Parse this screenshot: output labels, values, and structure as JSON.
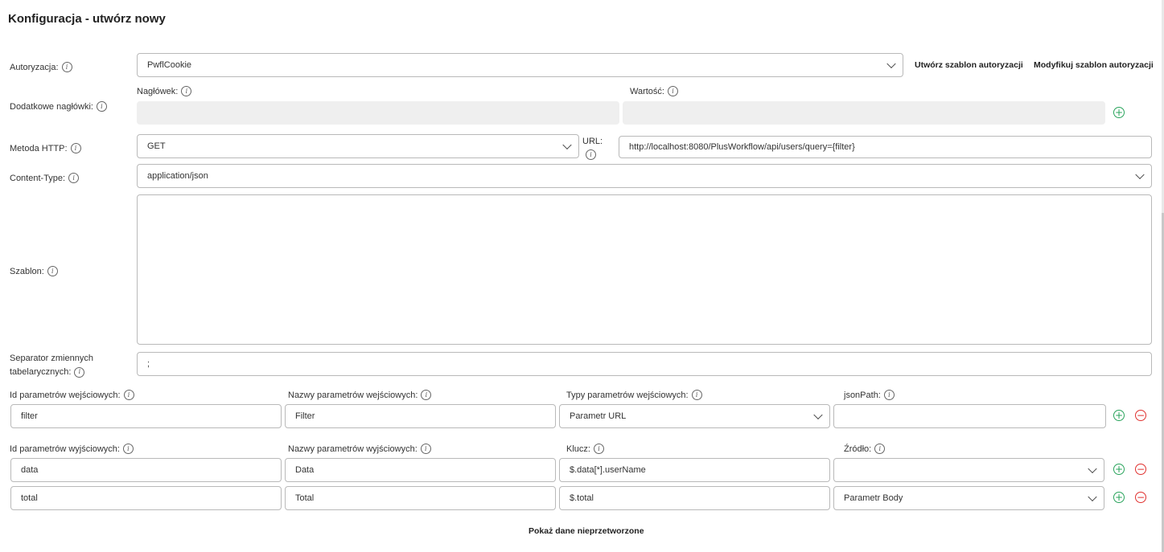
{
  "page": {
    "title": "Konfiguracja - utwórz nowy"
  },
  "auth": {
    "label": "Autoryzacja:",
    "value": "PwflCookie",
    "create_template": "Utwórz szablon autoryzacji",
    "modify_template": "Modyfikuj szablon autoryzacji"
  },
  "headers": {
    "label": "Dodatkowe nagłówki:",
    "header_label": "Nagłówek:",
    "value_label": "Wartość:",
    "header_value": "",
    "value_value": ""
  },
  "http": {
    "method_label": "Metoda HTTP:",
    "method_value": "GET",
    "url_label": "URL:",
    "url_value": "http://localhost:8080/PlusWorkflow/api/users/query={filter}"
  },
  "content_type": {
    "label": "Content-Type:",
    "value": "application/json"
  },
  "template": {
    "label": "Szablon:",
    "value": ""
  },
  "separator": {
    "label": "Separator zmiennych tabelarycznych:",
    "value": ";"
  },
  "input_params": {
    "headers": {
      "id": "Id parametrów wejściowych:",
      "name": "Nazwy parametrów wejściowych:",
      "type": "Typy parametrów wejściowych:",
      "jsonpath": "jsonPath:"
    },
    "rows": [
      {
        "id": "filter",
        "name": "Filter",
        "type": "Parametr URL",
        "jsonpath": ""
      }
    ]
  },
  "output_params": {
    "headers": {
      "id": "Id parametrów wyjściowych:",
      "name": "Nazwy parametrów wyjściowych:",
      "key": "Klucz:",
      "source": "Źródło:"
    },
    "rows": [
      {
        "id": "data",
        "name": "Data",
        "key": "$.data[*].userName",
        "source": ""
      },
      {
        "id": "total",
        "name": "Total",
        "key": "$.total",
        "source": "Parametr Body"
      }
    ]
  },
  "footer": {
    "raw_data_button": "Pokaż dane nieprzetworzone"
  },
  "icons": {
    "info": "info-icon",
    "dropdown": "chevron-down-icon",
    "add": "plus-circle-icon",
    "remove": "minus-circle-icon"
  },
  "colors": {
    "add": "#27a35a",
    "remove": "#e0312f",
    "field_bg_disabled": "#efefef"
  }
}
